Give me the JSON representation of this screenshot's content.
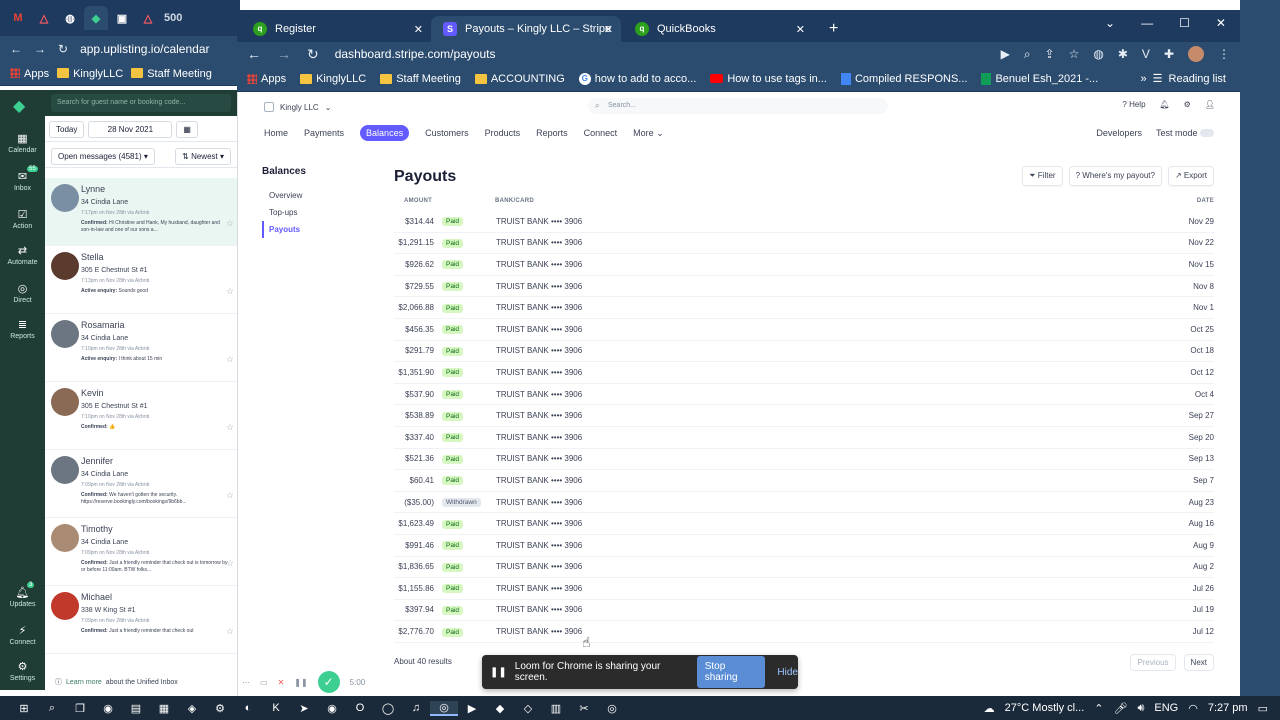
{
  "back_window": {
    "tab_count": "500",
    "url": "app.uplisting.io/calendar",
    "bookmarks": {
      "apps": "Apps",
      "kingly": "KinglyLLC",
      "staff": "Staff Meeting"
    }
  },
  "uplisting": {
    "search_placeholder": "Search for guest name or booking code...",
    "today": "Today",
    "date": "28 Nov 2021",
    "open_messages": "Open messages (4581)",
    "sort": "Newest",
    "nav": [
      {
        "label": "Calendar",
        "icon": "calendar-icon"
      },
      {
        "label": "Inbox",
        "icon": "inbox-icon",
        "badge": "55"
      },
      {
        "label": "Action",
        "icon": "check-icon"
      },
      {
        "label": "Automate",
        "icon": "shuffle-icon"
      },
      {
        "label": "Direct",
        "icon": "direct-icon"
      },
      {
        "label": "Reports",
        "icon": "reports-icon"
      }
    ],
    "nav_bottom": [
      {
        "label": "Updates",
        "icon": "bell-icon",
        "badge": "3"
      },
      {
        "label": "Connect",
        "icon": "plug-icon"
      },
      {
        "label": "Settings",
        "icon": "gear-icon"
      }
    ],
    "messages": [
      {
        "name": "Lynne",
        "address": "34 Cindia Lane",
        "time": "7:17pm on Nov 28th via Airbnb",
        "status": "Confirmed:",
        "preview": "Hi Christine and Hank, My husband, daughter and son-in-law and one of our sons a..."
      },
      {
        "name": "Stella",
        "address": "305 E Chestnut St #1",
        "time": "7:13pm on Nov 28th via Airbnb",
        "status": "Active enquiry:",
        "preview": "Sounds good"
      },
      {
        "name": "Rosamaria",
        "address": "34 Cindia Lane",
        "time": "7:10pm on Nov 28th via Airbnb",
        "status": "Active enquiry:",
        "preview": "I think about 15 min"
      },
      {
        "name": "Kevin",
        "address": "305 E Chestnut St #1",
        "time": "7:10pm on Nov 28th via Airbnb",
        "status": "Confirmed:",
        "preview": "👍"
      },
      {
        "name": "Jennifer",
        "address": "34 Cindia Lane",
        "time": "7:09pm on Nov 28th via Airbnb",
        "status": "Confirmed:",
        "preview": "We haven't gotten the security. https://reserve.bookingly.com/bookings/9b6bb..."
      },
      {
        "name": "Timothy",
        "address": "34 Cindia Lane",
        "time": "7:09pm on Nov 28th via Airbnb",
        "status": "Confirmed:",
        "preview": "Just a friendly reminder that check out is tomorrow by or before 11:00am. BTW folks..."
      },
      {
        "name": "Michael",
        "address": "338 W King St #1",
        "time": "7:09pm on Nov 28th via Airbnb",
        "status": "Confirmed:",
        "preview": "Just a friendly reminder that check out"
      }
    ],
    "footer_link": "Learn more",
    "footer_text": "about the Unified Inbox"
  },
  "front_window": {
    "tabs": [
      {
        "label": "Register"
      },
      {
        "label": "Payouts – Kingly LLC – Stripe"
      },
      {
        "label": "QuickBooks"
      }
    ],
    "url": "dashboard.stripe.com/payouts",
    "bookmarks": [
      "Apps",
      "KinglyLLC",
      "Staff Meeting",
      "ACCOUNTING",
      "how to add to acco...",
      "How to use tags in...",
      "Compiled RESPONS...",
      "Benuel Esh_2021 -..."
    ],
    "reading_list": "Reading list"
  },
  "stripe": {
    "account": "Kingly LLC",
    "search": "Search...",
    "help": "Help",
    "nav": [
      "Home",
      "Payments",
      "Balances",
      "Customers",
      "Products",
      "Reports",
      "Connect",
      "More"
    ],
    "developers": "Developers",
    "test_mode": "Test mode",
    "sidebar_title": "Balances",
    "sidebar": [
      "Overview",
      "Top-ups",
      "Payouts"
    ],
    "title": "Payouts",
    "actions": {
      "filter": "Filter",
      "where": "Where's my payout?",
      "export": "Export"
    },
    "columns": {
      "amount": "AMOUNT",
      "bank": "BANK/CARD",
      "date": "DATE"
    },
    "rows": [
      {
        "amount": "$314.44",
        "status": "Paid",
        "bank": "TRUIST BANK",
        "last4": "•••• 3906",
        "date": "Nov 29"
      },
      {
        "amount": "$1,291.15",
        "status": "Paid",
        "bank": "TRUIST BANK",
        "last4": "•••• 3906",
        "date": "Nov 22"
      },
      {
        "amount": "$926.62",
        "status": "Paid",
        "bank": "TRUIST BANK",
        "last4": "•••• 3906",
        "date": "Nov 15"
      },
      {
        "amount": "$729.55",
        "status": "Paid",
        "bank": "TRUIST BANK",
        "last4": "•••• 3906",
        "date": "Nov 8"
      },
      {
        "amount": "$2,066.88",
        "status": "Paid",
        "bank": "TRUIST BANK",
        "last4": "•••• 3906",
        "date": "Nov 1"
      },
      {
        "amount": "$456.35",
        "status": "Paid",
        "bank": "TRUIST BANK",
        "last4": "•••• 3906",
        "date": "Oct 25"
      },
      {
        "amount": "$291.79",
        "status": "Paid",
        "bank": "TRUIST BANK",
        "last4": "•••• 3906",
        "date": "Oct 18"
      },
      {
        "amount": "$1,351.90",
        "status": "Paid",
        "bank": "TRUIST BANK",
        "last4": "•••• 3906",
        "date": "Oct 12"
      },
      {
        "amount": "$537.90",
        "status": "Paid",
        "bank": "TRUIST BANK",
        "last4": "•••• 3906",
        "date": "Oct 4"
      },
      {
        "amount": "$538.89",
        "status": "Paid",
        "bank": "TRUIST BANK",
        "last4": "•••• 3906",
        "date": "Sep 27"
      },
      {
        "amount": "$337.40",
        "status": "Paid",
        "bank": "TRUIST BANK",
        "last4": "•••• 3906",
        "date": "Sep 20"
      },
      {
        "amount": "$521.36",
        "status": "Paid",
        "bank": "TRUIST BANK",
        "last4": "•••• 3906",
        "date": "Sep 13"
      },
      {
        "amount": "$60.41",
        "status": "Paid",
        "bank": "TRUIST BANK",
        "last4": "•••• 3906",
        "date": "Sep 7"
      },
      {
        "amount": "($35.00)",
        "status": "Withdrawn",
        "bank": "TRUIST BANK",
        "last4": "•••• 3906",
        "date": "Aug 23"
      },
      {
        "amount": "$1,623.49",
        "status": "Paid",
        "bank": "TRUIST BANK",
        "last4": "•••• 3906",
        "date": "Aug 16"
      },
      {
        "amount": "$991.46",
        "status": "Paid",
        "bank": "TRUIST BANK",
        "last4": "•••• 3906",
        "date": "Aug 9"
      },
      {
        "amount": "$1,836.65",
        "status": "Paid",
        "bank": "TRUIST BANK",
        "last4": "•••• 3906",
        "date": "Aug 2"
      },
      {
        "amount": "$1,155.86",
        "status": "Paid",
        "bank": "TRUIST BANK",
        "last4": "•••• 3906",
        "date": "Jul 26"
      },
      {
        "amount": "$397.94",
        "status": "Paid",
        "bank": "TRUIST BANK",
        "last4": "•••• 3906",
        "date": "Jul 19"
      },
      {
        "amount": "$2,776.70",
        "status": "Paid",
        "bank": "TRUIST BANK",
        "last4": "•••• 3906",
        "date": "Jul 12"
      }
    ],
    "result_count": "About 40 results",
    "previous": "Previous",
    "next": "Next"
  },
  "loom": {
    "message": "Loom for Chrome is sharing your screen.",
    "stop": "Stop sharing",
    "hide": "Hide",
    "timer": "5:00"
  },
  "taskbar": {
    "weather": "27°C  Mostly cl...",
    "lang": "ENG",
    "time": "7:27 pm"
  }
}
